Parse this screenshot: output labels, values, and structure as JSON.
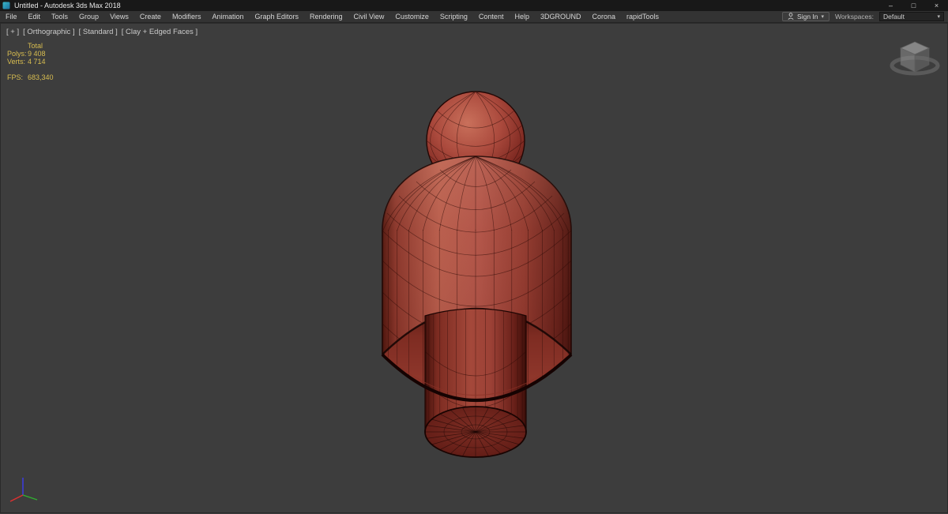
{
  "window": {
    "title": "Untitled - Autodesk 3ds Max 2018",
    "minimize_glyph": "–",
    "maximize_glyph": "□",
    "close_glyph": "×"
  },
  "menubar": {
    "items": [
      "File",
      "Edit",
      "Tools",
      "Group",
      "Views",
      "Create",
      "Modifiers",
      "Animation",
      "Graph Editors",
      "Rendering",
      "Civil View",
      "Customize",
      "Scripting",
      "Content",
      "Help",
      "3DGROUND",
      "Corona",
      "rapidTools"
    ],
    "sign_in_label": "Sign In",
    "dropdown_glyph": "▾",
    "workspaces_label": "Workspaces:",
    "workspace_value": "Default"
  },
  "viewport": {
    "label_segments": [
      "[ + ]",
      "[ Orthographic ]",
      "[ Standard ]",
      "[ Clay + Edged Faces ]"
    ],
    "stats": {
      "total_label": "Total",
      "rows": [
        {
          "label": "Polys:",
          "value": "9 408"
        },
        {
          "label": "Verts:",
          "value": "4 714"
        }
      ],
      "fps_label": "FPS:",
      "fps_value": "683,340"
    }
  },
  "colors": {
    "viewport_background": "#3d3d3d",
    "clay_red": "#b05246",
    "stats_text": "#d8bd50",
    "wireframe_edge": "#2a0a06"
  }
}
